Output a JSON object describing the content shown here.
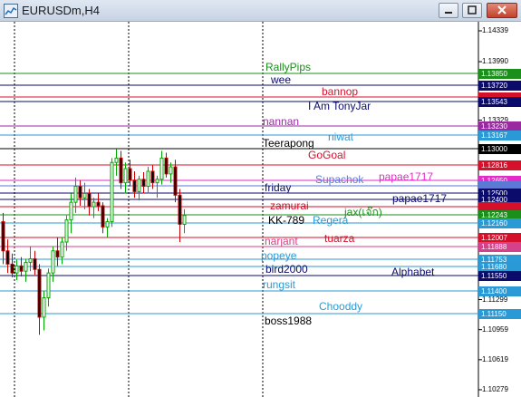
{
  "window": {
    "title": "EURUSDm,H4",
    "buttons": {
      "minimize": "minimize",
      "maximize": "maximize",
      "close": "close"
    }
  },
  "axis": {
    "tick_labels": [
      "1.14339",
      "1.13990",
      "1.13329",
      "1.11299",
      "1.10959",
      "1.10619",
      "1.10279"
    ]
  },
  "annotations": [
    {
      "text": "RallyPips",
      "color": "#1a8f1a"
    },
    {
      "text": "wee",
      "color": "#0b0b6b"
    },
    {
      "text": "bannop",
      "color": "#d4102a"
    },
    {
      "text": "I Am TonyJar",
      "color": "#0b0b6b"
    },
    {
      "text": "nannan",
      "color": "#9a2aa0"
    },
    {
      "text": "niwat",
      "color": "#2a9ad6"
    },
    {
      "text": "Teerapong",
      "color": "#000000"
    },
    {
      "text": "GoGoal",
      "color": "#d4102a"
    },
    {
      "text": "Supachok",
      "color": "#5a7ad6"
    },
    {
      "text": "papae1717",
      "color": "#e42ac8"
    },
    {
      "text": "friday",
      "color": "#0b0b6b"
    },
    {
      "text": "papae1717",
      "color": "#0b0b6b"
    },
    {
      "text": "zamurai",
      "color": "#d4102a"
    },
    {
      "text": "jax(เจ๊ก)",
      "color": "#1a8f1a"
    },
    {
      "text": "KK-789",
      "color": "#000000"
    },
    {
      "text": "Regera",
      "color": "#2a9ad6"
    },
    {
      "text": "narjant",
      "color": "#d4408a"
    },
    {
      "text": "tuarza",
      "color": "#d4102a"
    },
    {
      "text": "popeye",
      "color": "#2a9ad6"
    },
    {
      "text": "bird2000",
      "color": "#0b0b6b"
    },
    {
      "text": "Alphabet",
      "color": "#0b0b6b"
    },
    {
      "text": "rungsit",
      "color": "#2a9ad6"
    },
    {
      "text": "Chooddy",
      "color": "#2a9ad6"
    },
    {
      "text": "boss1988",
      "color": "#000000"
    }
  ],
  "price_boxes": [
    {
      "text": "1.13850",
      "color": "#1a8f1a"
    },
    {
      "text": "1.13720",
      "color": "#0b0b6b"
    },
    {
      "text": "",
      "color": "#d4102a"
    },
    {
      "text": "1.13543",
      "color": "#0b0b6b"
    },
    {
      "text": "1.13230",
      "color": "#9a2aa0"
    },
    {
      "text": "1.13167",
      "color": "#2a9ad6"
    },
    {
      "text": "1.13000",
      "color": "#000000"
    },
    {
      "text": "1.12816",
      "color": "#d4102a"
    },
    {
      "text": "1.12650",
      "color": "#e42ac8"
    },
    {
      "text": "",
      "color": "#5a7ad6"
    },
    {
      "text": "1.12500",
      "color": "#0b0b6b"
    },
    {
      "text": "1.12400",
      "color": "#0b0b6b"
    },
    {
      "text": "",
      "color": "#d4102a"
    },
    {
      "text": "1.12243",
      "color": "#1a8f1a"
    },
    {
      "text": "1.12160",
      "color": "#2a9ad6"
    },
    {
      "text": "1.12007",
      "color": "#d4102a"
    },
    {
      "text": "1.11888",
      "color": "#d4408a"
    },
    {
      "text": "1.11753",
      "color": "#2a9ad6"
    },
    {
      "text": "1.11680",
      "color": "#2a9ad6"
    },
    {
      "text": "1.11550",
      "color": "#0b0b6b"
    },
    {
      "text": "1.11400",
      "color": "#2a9ad6"
    },
    {
      "text": "1.11150",
      "color": "#2a9ad6"
    }
  ],
  "chart_data": {
    "type": "candlestick",
    "symbol": "EURUSDm",
    "timeframe": "H4",
    "ylim": [
      1.10279,
      1.14339
    ],
    "candles": [
      [
        1.1218,
        1.1228,
        1.117,
        1.1185
      ],
      [
        1.1185,
        1.1198,
        1.116,
        1.117
      ],
      [
        1.117,
        1.1182,
        1.1155,
        1.116
      ],
      [
        1.116,
        1.1175,
        1.1152,
        1.1168
      ],
      [
        1.1168,
        1.1178,
        1.1156,
        1.1162
      ],
      [
        1.1162,
        1.1176,
        1.115,
        1.1172
      ],
      [
        1.1172,
        1.119,
        1.1162,
        1.1176
      ],
      [
        1.1176,
        1.1185,
        1.1158,
        1.1164
      ],
      [
        1.1164,
        1.117,
        1.109,
        1.111
      ],
      [
        1.111,
        1.114,
        1.1095,
        1.1132
      ],
      [
        1.1132,
        1.1165,
        1.1122,
        1.116
      ],
      [
        1.116,
        1.119,
        1.115,
        1.1185
      ],
      [
        1.1185,
        1.12,
        1.1168,
        1.1178
      ],
      [
        1.1178,
        1.12,
        1.117,
        1.1195
      ],
      [
        1.1195,
        1.1225,
        1.1185,
        1.122
      ],
      [
        1.122,
        1.125,
        1.1205,
        1.124
      ],
      [
        1.124,
        1.1268,
        1.1228,
        1.1258
      ],
      [
        1.1258,
        1.1265,
        1.1236,
        1.1245
      ],
      [
        1.1245,
        1.1262,
        1.1232,
        1.125
      ],
      [
        1.125,
        1.1255,
        1.1225,
        1.1235
      ],
      [
        1.1235,
        1.1245,
        1.1222,
        1.124
      ],
      [
        1.124,
        1.125,
        1.123,
        1.1236
      ],
      [
        1.1236,
        1.124,
        1.1205,
        1.1212
      ],
      [
        1.1212,
        1.1222,
        1.12,
        1.1218
      ],
      [
        1.1218,
        1.129,
        1.1212,
        1.1285
      ],
      [
        1.1285,
        1.13,
        1.127,
        1.129
      ],
      [
        1.129,
        1.1298,
        1.1255,
        1.1262
      ],
      [
        1.1262,
        1.1285,
        1.125,
        1.1278
      ],
      [
        1.1278,
        1.1288,
        1.1258,
        1.1265
      ],
      [
        1.1265,
        1.1275,
        1.1245,
        1.1252
      ],
      [
        1.1252,
        1.127,
        1.1242,
        1.1266
      ],
      [
        1.1266,
        1.1274,
        1.125,
        1.1258
      ],
      [
        1.1258,
        1.128,
        1.125,
        1.1275
      ],
      [
        1.1275,
        1.1282,
        1.1255,
        1.1262
      ],
      [
        1.1262,
        1.127,
        1.1245,
        1.1266
      ],
      [
        1.1266,
        1.1298,
        1.126,
        1.129
      ],
      [
        1.129,
        1.1296,
        1.1268,
        1.1272
      ],
      [
        1.1272,
        1.1285,
        1.1262,
        1.128
      ],
      [
        1.128,
        1.1288,
        1.124,
        1.1248
      ],
      [
        1.1248,
        1.1255,
        1.1195,
        1.1215
      ],
      [
        1.1215,
        1.1232,
        1.1205,
        1.1225
      ]
    ]
  }
}
